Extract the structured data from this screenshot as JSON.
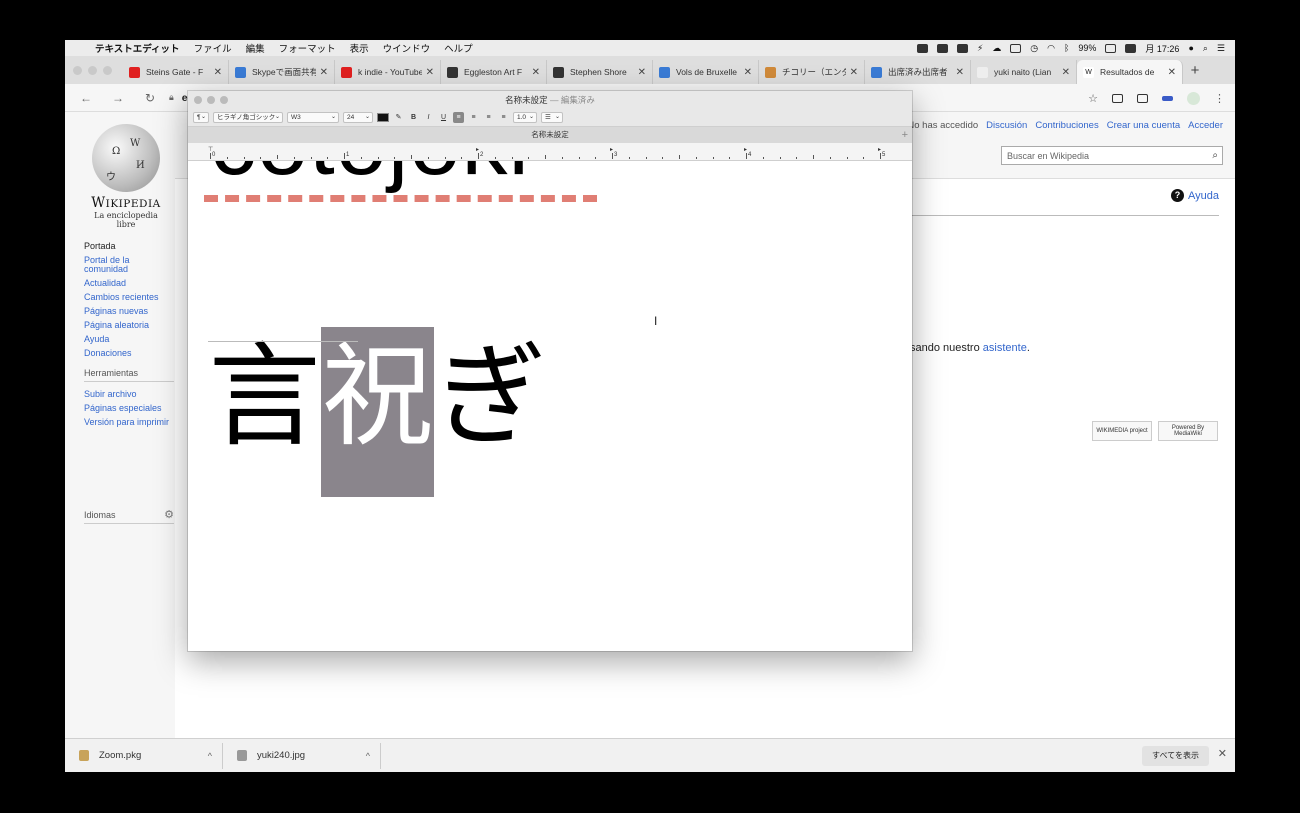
{
  "menubar": {
    "items": [
      "テキストエディット",
      "ファイル",
      "編集",
      "フォーマット",
      "表示",
      "ウインドウ",
      "ヘルプ"
    ],
    "battery": "99%",
    "clock": "月 17:26"
  },
  "tabs": [
    {
      "label": "Steins Gate - F",
      "icon_color": "#e02020"
    },
    {
      "label": "Skypeで画面共有",
      "icon_color": "#3a7bd5"
    },
    {
      "label": "k indie - YouTube",
      "icon_color": "#e02020"
    },
    {
      "label": "Eggleston Art F",
      "icon_color": "#333333"
    },
    {
      "label": "Stephen Shore",
      "icon_color": "#333333"
    },
    {
      "label": "Vols de Bruxelle",
      "icon_color": "#3a7bd5"
    },
    {
      "label": "チコリー（エンダ",
      "icon_color": "#d08a3a"
    },
    {
      "label": "出席済み出席者",
      "icon_color": "#3a7bd5"
    },
    {
      "label": "yuki naito (Lian",
      "icon_color": "#eeeeee"
    },
    {
      "label": "Resultados de",
      "icon_color": "#ffffff"
    }
  ],
  "url": "es.wi",
  "wiki": {
    "wordmark": "Wikipedia",
    "tagline": "La enciclopedia libre",
    "nav": [
      "Portada",
      "Portal de la comunidad",
      "Actualidad",
      "Cambios recientes",
      "Páginas nuevas",
      "Página aleatoria",
      "Ayuda",
      "Donaciones"
    ],
    "tools_heading": "Herramientas",
    "tools": [
      "Subir archivo",
      "Páginas especiales",
      "Versión para imprimir"
    ],
    "languages": "Idiomas",
    "user_links": {
      "not_logged": "No has accedido",
      "talk": "Discusión",
      "contribs": "Contribuciones",
      "create": "Crear una cuenta",
      "login": "Acceder"
    },
    "search_placeholder": "Buscar en Wikipedia",
    "help": "Ayuda",
    "message_prefix": "sando nuestro ",
    "message_link": "asistente",
    "message_suffix": ".",
    "badges": [
      "WIKIMEDIA project",
      "Powered By MediaWiki"
    ]
  },
  "downloads": {
    "items": [
      "Zoom.pkg",
      "yuki240.jpg"
    ],
    "show_all": "すべてを表示"
  },
  "textedit": {
    "title": "名称未設定",
    "edited": "— 編集済み",
    "tab": "名称未設定",
    "font_family": "ヒラギノ角ゴシック",
    "font_weight": "W3",
    "font_size": "24",
    "line_spacing": "1.0",
    "ruler_numbers": [
      "0",
      "1",
      "2",
      "3",
      "4",
      "5"
    ],
    "big_word": "cotojoki",
    "jp_chars": [
      "言",
      "祝",
      "ぎ"
    ],
    "selected_index": 1
  }
}
